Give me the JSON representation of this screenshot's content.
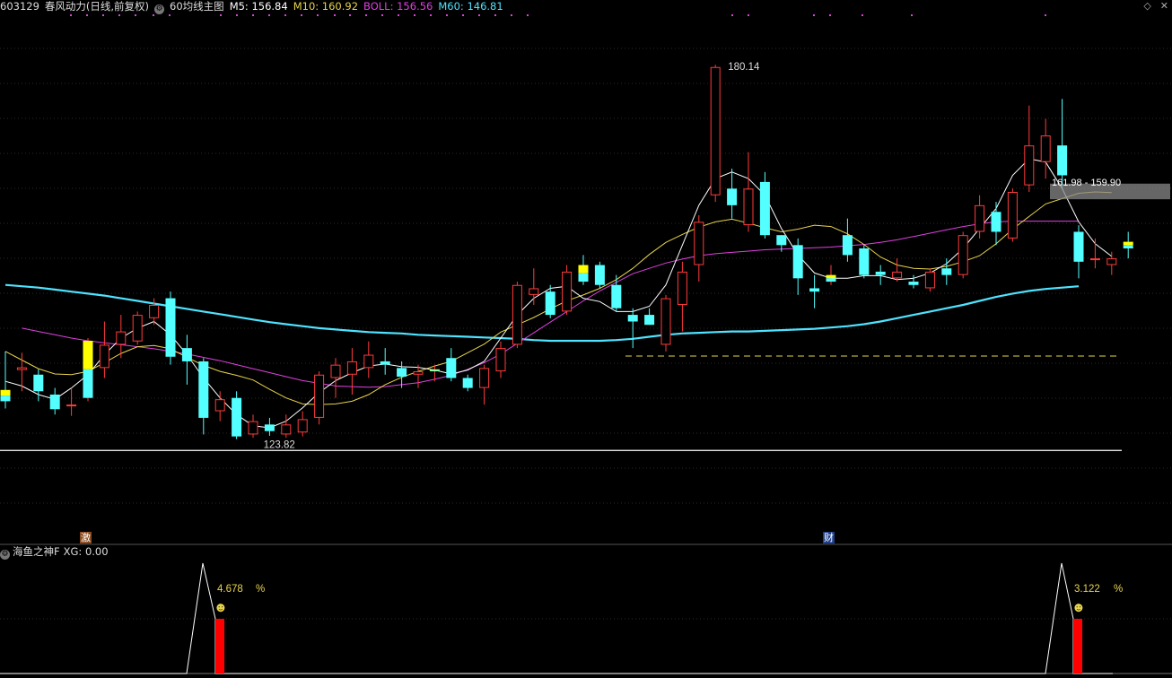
{
  "header": {
    "code": "603129",
    "name": "春风动力",
    "mode": "(日线,前复权)",
    "indicator": "60均线主图",
    "m5_label": "M5: 156.84",
    "m10_label": "M10: 160.92",
    "boll_label": "BOLL: 156.56",
    "m60_label": "M60: 146.81"
  },
  "colors": {
    "up": "#ff3b3b",
    "down": "#54ffff",
    "highlight": "#ffff00",
    "m5": "#ffffff",
    "m10": "#e8d44c",
    "boll": "#e040e0",
    "m60": "#4fe3ff",
    "support": "#e8d44c",
    "indicator_bar": "#ff0000"
  },
  "icons": {
    "menu": "diamond-icon",
    "close": "close-icon",
    "settings": "gear-icon"
  },
  "markers": {
    "left": "激",
    "right": "财"
  },
  "indicator_panel": {
    "title": "海鱼之神F",
    "xg_label": "XG: 0.00",
    "left_value": "4.678",
    "right_value": "3.122",
    "pct": "%",
    "emoji": "☻"
  },
  "chart_data": {
    "type": "candlestick",
    "ylim": [
      117,
      188
    ],
    "high_label": "180.14",
    "low_label": "123.82",
    "range_label": "161.98 - 159.90",
    "range_band": [
      159.9,
      161.98
    ],
    "support_level": 136.3,
    "baseline_level": 122.1,
    "candles": [
      {
        "o": 131.2,
        "h": 137.0,
        "l": 128.4,
        "c": 129.5,
        "hl": true
      },
      {
        "o": 134.2,
        "h": 136.8,
        "l": 131.0,
        "c": 134.6
      },
      {
        "o": 133.5,
        "h": 134.3,
        "l": 129.5,
        "c": 131.0
      },
      {
        "o": 130.5,
        "h": 131.5,
        "l": 127.5,
        "c": 128.3
      },
      {
        "o": 128.8,
        "h": 131.5,
        "l": 127.3,
        "c": 129.0
      },
      {
        "o": 130.0,
        "h": 139.0,
        "l": 129.5,
        "c": 138.6,
        "hl": true
      },
      {
        "o": 134.5,
        "h": 141.5,
        "l": 133.0,
        "c": 138.0
      },
      {
        "o": 138.0,
        "h": 142.5,
        "l": 136.0,
        "c": 140.0
      },
      {
        "o": 138.5,
        "h": 143.0,
        "l": 138.0,
        "c": 142.5
      },
      {
        "o": 142.0,
        "h": 145.0,
        "l": 141.0,
        "c": 144.0
      },
      {
        "o": 145.0,
        "h": 146.0,
        "l": 135.0,
        "c": 136.2
      },
      {
        "o": 137.5,
        "h": 139.5,
        "l": 132.0,
        "c": 135.5
      },
      {
        "o": 135.5,
        "h": 136.0,
        "l": 124.5,
        "c": 127.0
      },
      {
        "o": 128.0,
        "h": 131.0,
        "l": 126.5,
        "c": 129.8
      },
      {
        "o": 130.0,
        "h": 131.0,
        "l": 123.8,
        "c": 124.2
      },
      {
        "o": 124.5,
        "h": 127.5,
        "l": 124.0,
        "c": 126.5
      },
      {
        "o": 126.0,
        "h": 127.0,
        "l": 124.3,
        "c": 125.0
      },
      {
        "o": 124.5,
        "h": 127.5,
        "l": 124.0,
        "c": 126.0
      },
      {
        "o": 124.8,
        "h": 128.0,
        "l": 124.2,
        "c": 126.8
      },
      {
        "o": 127.0,
        "h": 134.0,
        "l": 126.0,
        "c": 133.5
      },
      {
        "o": 133.0,
        "h": 136.0,
        "l": 130.0,
        "c": 135.0
      },
      {
        "o": 133.5,
        "h": 137.5,
        "l": 130.5,
        "c": 135.5
      },
      {
        "o": 134.5,
        "h": 138.5,
        "l": 133.0,
        "c": 136.5
      },
      {
        "o": 135.5,
        "h": 137.5,
        "l": 133.5,
        "c": 135.0
      },
      {
        "o": 134.5,
        "h": 135.5,
        "l": 131.5,
        "c": 133.2
      },
      {
        "o": 133.5,
        "h": 135.0,
        "l": 131.5,
        "c": 134.0
      },
      {
        "o": 134.0,
        "h": 135.0,
        "l": 132.5,
        "c": 134.3,
        "hl": true
      },
      {
        "o": 136.0,
        "h": 137.5,
        "l": 132.5,
        "c": 133.0
      },
      {
        "o": 133.0,
        "h": 133.5,
        "l": 131.0,
        "c": 131.5
      },
      {
        "o": 131.5,
        "h": 135.0,
        "l": 129.0,
        "c": 134.5
      },
      {
        "o": 134.0,
        "h": 138.5,
        "l": 133.0,
        "c": 137.5
      },
      {
        "o": 138.0,
        "h": 147.5,
        "l": 137.5,
        "c": 147.0
      },
      {
        "o": 145.5,
        "h": 149.5,
        "l": 144.0,
        "c": 146.5
      },
      {
        "o": 146.0,
        "h": 147.0,
        "l": 142.0,
        "c": 142.5
      },
      {
        "o": 143.0,
        "h": 150.0,
        "l": 142.5,
        "c": 149.0
      },
      {
        "o": 150.0,
        "h": 151.5,
        "l": 147.0,
        "c": 147.5,
        "hl": true
      },
      {
        "o": 150.0,
        "h": 150.5,
        "l": 146.5,
        "c": 147.0
      },
      {
        "o": 147.0,
        "h": 148.5,
        "l": 143.0,
        "c": 143.5
      },
      {
        "o": 142.5,
        "h": 143.5,
        "l": 137.5,
        "c": 141.5
      },
      {
        "o": 142.5,
        "h": 143.5,
        "l": 141.0,
        "c": 141.0
      },
      {
        "o": 138.0,
        "h": 145.5,
        "l": 137.0,
        "c": 145.0
      },
      {
        "o": 144.0,
        "h": 150.5,
        "l": 140.0,
        "c": 149.0
      },
      {
        "o": 150.0,
        "h": 157.5,
        "l": 147.5,
        "c": 156.5
      },
      {
        "o": 160.5,
        "h": 180.14,
        "l": 159.5,
        "c": 179.8
      },
      {
        "o": 161.5,
        "h": 164.5,
        "l": 157.0,
        "c": 159.0
      },
      {
        "o": 156.0,
        "h": 167.0,
        "l": 155.0,
        "c": 161.5
      },
      {
        "o": 162.5,
        "h": 164.0,
        "l": 154.0,
        "c": 154.5
      },
      {
        "o": 154.5,
        "h": 154.5,
        "l": 152.0,
        "c": 153.0
      },
      {
        "o": 153.0,
        "h": 154.0,
        "l": 145.5,
        "c": 148.0
      },
      {
        "o": 146.5,
        "h": 148.5,
        "l": 143.5,
        "c": 146.0
      },
      {
        "o": 147.5,
        "h": 150.0,
        "l": 147.0,
        "c": 148.5,
        "hl": true
      },
      {
        "o": 154.5,
        "h": 157.0,
        "l": 150.5,
        "c": 151.5
      },
      {
        "o": 152.5,
        "h": 153.0,
        "l": 148.0,
        "c": 148.5
      },
      {
        "o": 149.0,
        "h": 150.0,
        "l": 147.0,
        "c": 148.5
      },
      {
        "o": 148.0,
        "h": 151.0,
        "l": 147.5,
        "c": 149.0
      },
      {
        "o": 147.5,
        "h": 148.5,
        "l": 146.5,
        "c": 147.0
      },
      {
        "o": 146.5,
        "h": 149.5,
        "l": 146.0,
        "c": 149.0
      },
      {
        "o": 149.5,
        "h": 151.0,
        "l": 147.0,
        "c": 148.5
      },
      {
        "o": 148.5,
        "h": 155.0,
        "l": 148.0,
        "c": 154.5
      },
      {
        "o": 155.0,
        "h": 160.5,
        "l": 154.0,
        "c": 159.0
      },
      {
        "o": 158.0,
        "h": 159.5,
        "l": 153.0,
        "c": 155.0
      },
      {
        "o": 154.0,
        "h": 161.5,
        "l": 153.5,
        "c": 161.0
      },
      {
        "o": 162.0,
        "h": 174.0,
        "l": 161.0,
        "c": 168.0
      },
      {
        "o": 165.5,
        "h": 172.0,
        "l": 163.0,
        "c": 169.5
      },
      {
        "o": 168.0,
        "h": 175.0,
        "l": 161.5,
        "c": 163.5
      },
      {
        "o": 155.0,
        "h": 156.0,
        "l": 148.0,
        "c": 150.5
      },
      {
        "o": 151.0,
        "h": 154.0,
        "l": 149.5,
        "c": 151.0
      },
      {
        "o": 150.0,
        "h": 152.0,
        "l": 148.5,
        "c": 151.0
      },
      {
        "o": 153.5,
        "h": 155.0,
        "l": 151.0,
        "c": 152.5,
        "hl": true
      }
    ],
    "m5": [
      132.5,
      131.8,
      130.5,
      129.8,
      131.5,
      133.5,
      136.5,
      139.0,
      140.5,
      141.5,
      139.5,
      136.5,
      133.0,
      130.0,
      127.5,
      125.8,
      125.5,
      126.5,
      128.5,
      130.8,
      132.6,
      133.8,
      134.8,
      135.1,
      134.7,
      134.6,
      134.2,
      133.6,
      134.2,
      135.5,
      139.0,
      142.5,
      145.0,
      146.5,
      146.8,
      145.0,
      144.5,
      143.0,
      143.0,
      143.8,
      147.0,
      153.0,
      159.0,
      163.0,
      164.0,
      163.0,
      160.5,
      155.5,
      151.5,
      148.8,
      148.0,
      148.0,
      148.4,
      148.4,
      147.8,
      148.0,
      148.8,
      150.2,
      152.5,
      155.5,
      158.5,
      163.5,
      166.0,
      165.5,
      161.5,
      156.5,
      153.2,
      151.3
    ],
    "m10": [
      137.0,
      135.7,
      134.4,
      133.6,
      133.5,
      134.0,
      135.3,
      136.7,
      137.7,
      137.9,
      137.4,
      136.1,
      134.9,
      134.0,
      133.4,
      132.7,
      131.3,
      130.0,
      129.1,
      129.0,
      129.1,
      129.5,
      130.5,
      132.0,
      133.1,
      134.0,
      134.8,
      135.5,
      136.8,
      138.1,
      139.9,
      141.0,
      142.1,
      143.4,
      144.6,
      145.5,
      146.5,
      147.8,
      149.5,
      151.6,
      153.4,
      154.6,
      155.7,
      156.5,
      156.9,
      156.3,
      155.6,
      155.0,
      155.4,
      156.0,
      155.8,
      154.7,
      153.1,
      151.2,
      150.0,
      149.5,
      149.4,
      149.8,
      150.5,
      151.4,
      153.2,
      155.4,
      157.3,
      159.2,
      160.0,
      160.8,
      161.0,
      160.9
    ],
    "boll": [
      140.5,
      140.0,
      139.5,
      139.0,
      138.6,
      138.3,
      138.0,
      137.7,
      137.4,
      137.0,
      136.6,
      136.1,
      135.6,
      135.0,
      134.4,
      133.8,
      133.2,
      132.6,
      132.2,
      131.8,
      131.7,
      131.6,
      131.7,
      132.0,
      132.3,
      132.8,
      133.4,
      134.3,
      135.3,
      136.6,
      138.2,
      139.8,
      141.4,
      143.0,
      144.6,
      146.1,
      147.4,
      148.7,
      149.5,
      150.3,
      150.9,
      151.4,
      151.7,
      151.9,
      152.1,
      152.3,
      152.4,
      152.5,
      152.6,
      152.7,
      152.9,
      153.1,
      153.4,
      153.8,
      154.3,
      154.8,
      155.3,
      155.8,
      156.2,
      156.5,
      156.6,
      156.6,
      156.6,
      156.6,
      156.6
    ],
    "m60": [
      147.0,
      146.8,
      146.6,
      146.3,
      146.0,
      145.7,
      145.4,
      145.0,
      144.6,
      144.2,
      143.8,
      143.4,
      143.0,
      142.6,
      142.2,
      141.8,
      141.4,
      141.1,
      140.8,
      140.5,
      140.3,
      140.1,
      139.9,
      139.8,
      139.7,
      139.5,
      139.4,
      139.3,
      139.2,
      139.1,
      139.0,
      138.9,
      138.7,
      138.6,
      138.6,
      138.6,
      138.6,
      138.7,
      138.9,
      139.2,
      139.5,
      139.7,
      139.8,
      139.9,
      140.0,
      140.0,
      140.1,
      140.2,
      140.3,
      140.4,
      140.6,
      140.8,
      141.1,
      141.5,
      142.0,
      142.5,
      143.0,
      143.5,
      144.0,
      144.6,
      145.2,
      145.7,
      146.1,
      146.4,
      146.6,
      146.81
    ]
  }
}
